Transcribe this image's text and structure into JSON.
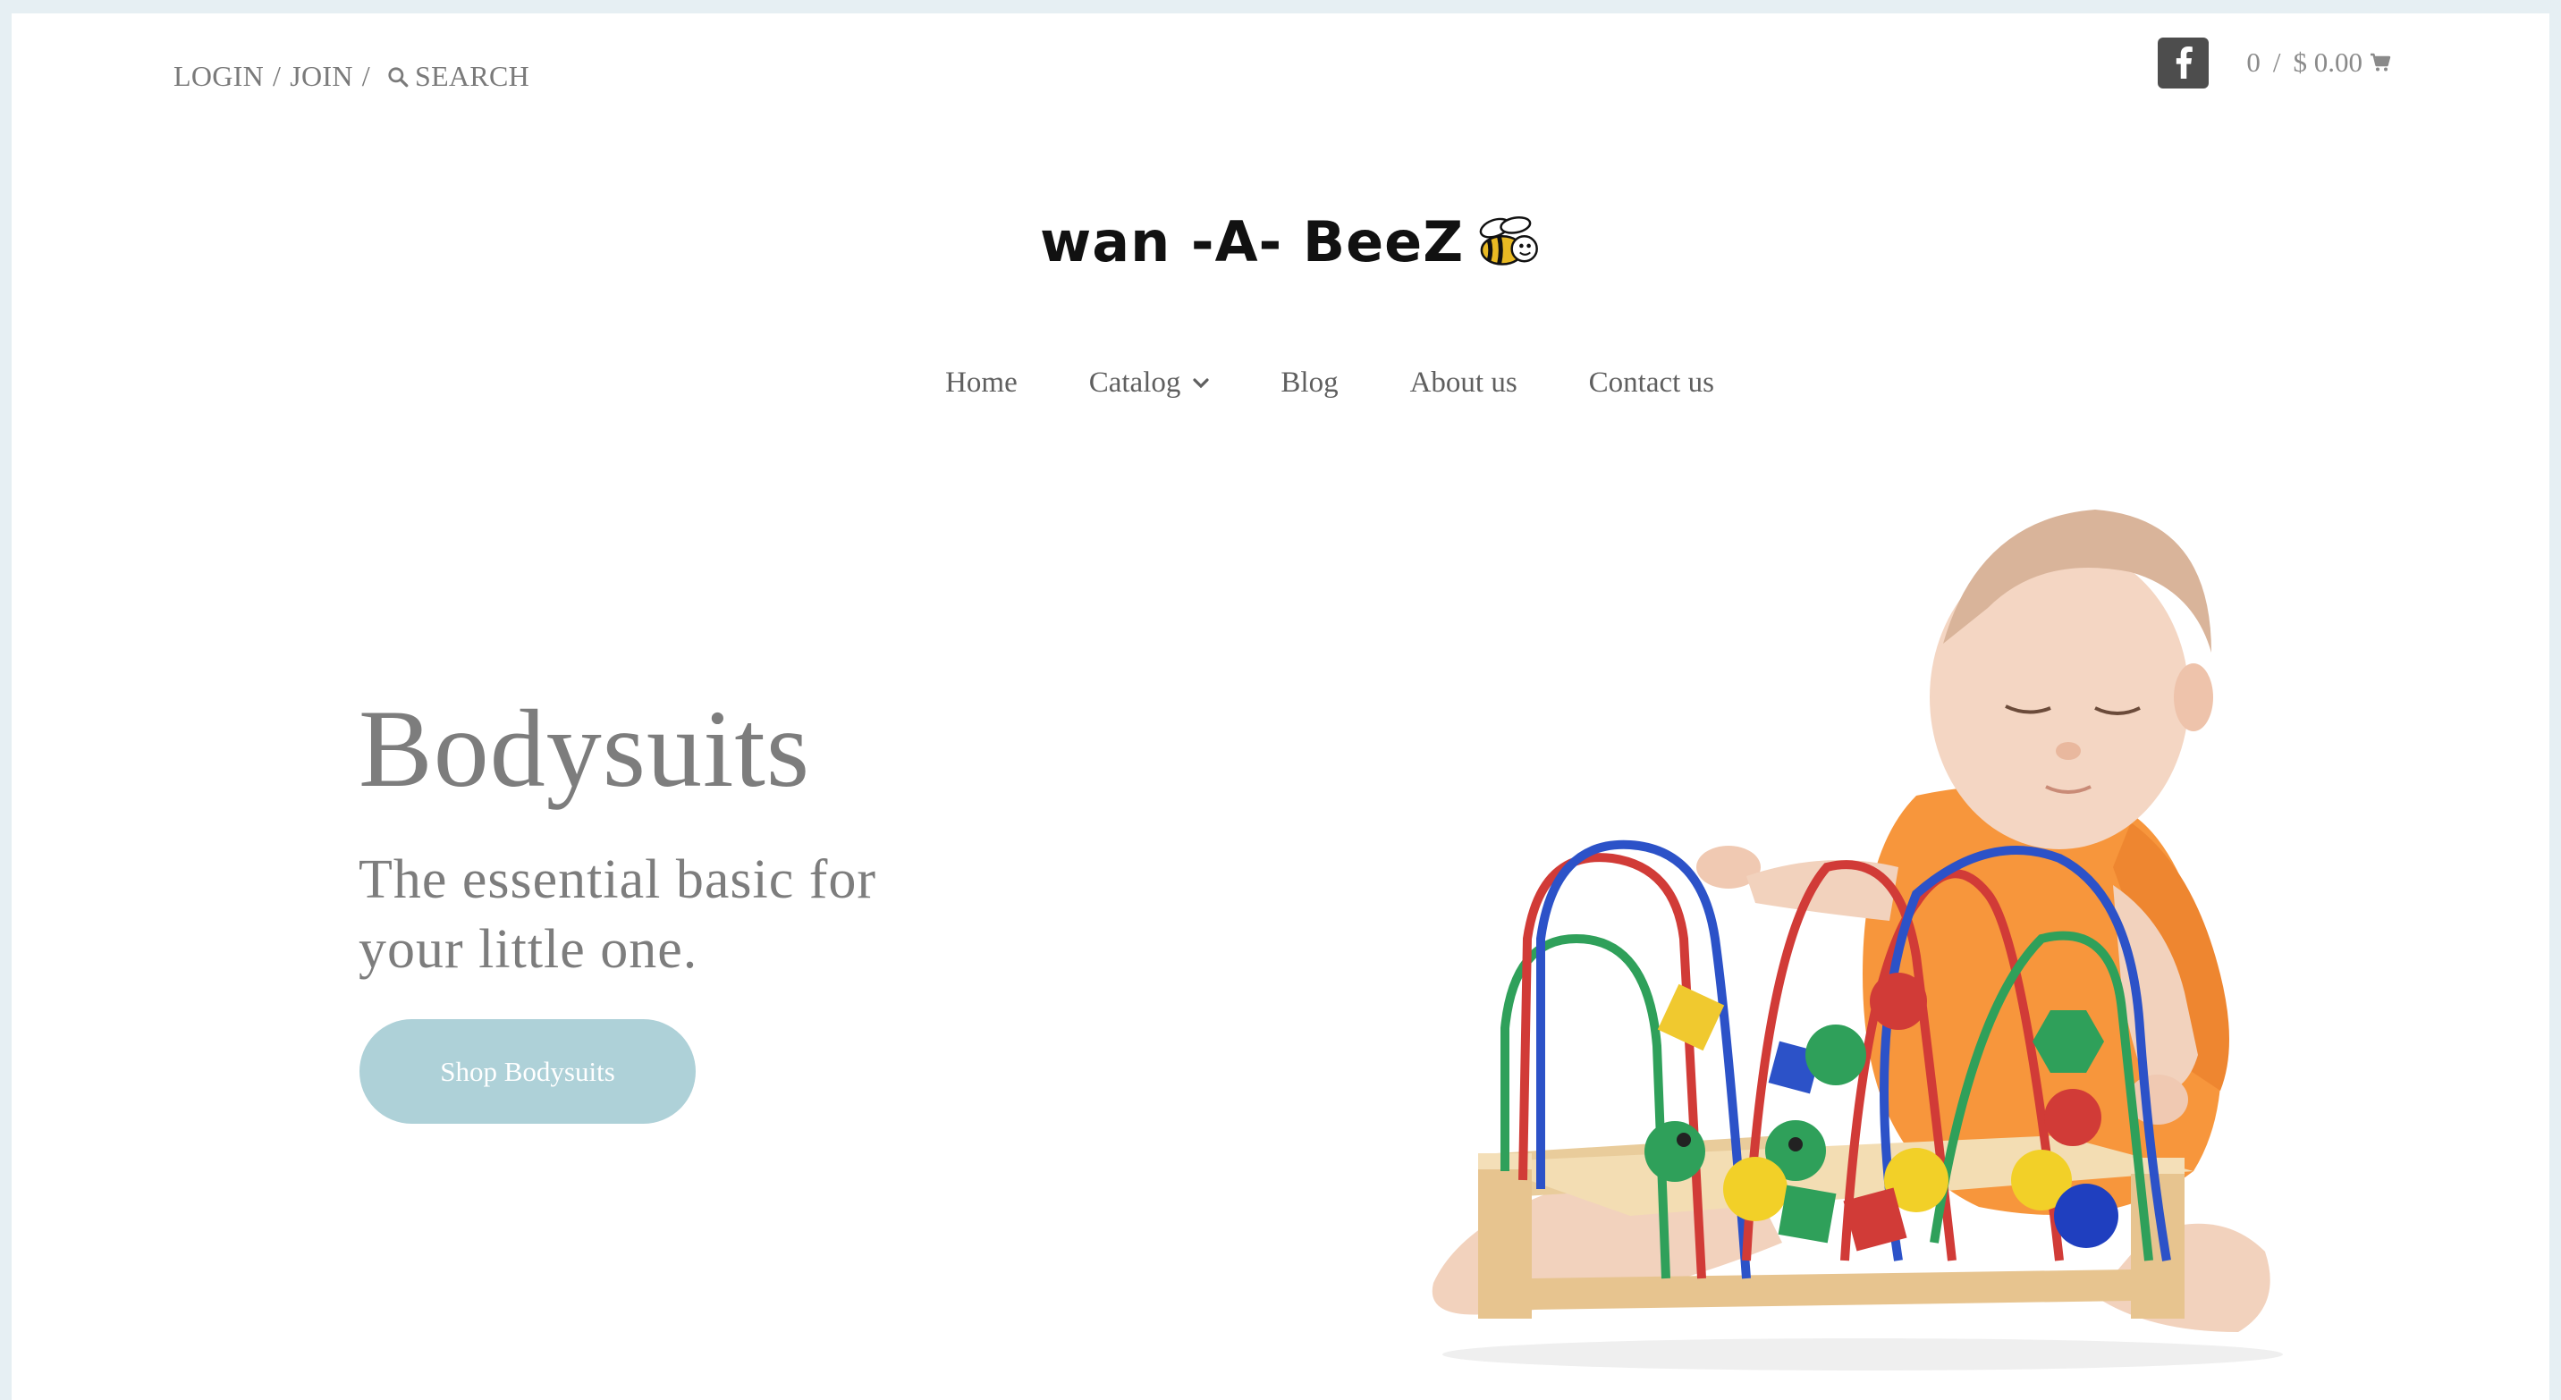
{
  "topbar": {
    "login_label": "LOGIN",
    "separator": "/",
    "join_label": "JOIN",
    "search_label": "SEARCH",
    "cart_count": "0",
    "cart_total": "$ 0.00"
  },
  "logo": {
    "text": "wan -A- BeeZ"
  },
  "nav": {
    "items": [
      {
        "label": "Home"
      },
      {
        "label": "Catalog"
      },
      {
        "label": "Blog"
      },
      {
        "label": "About us"
      },
      {
        "label": "Contact us"
      }
    ]
  },
  "hero": {
    "title": "Bodysuits",
    "subtitle": "The essential basic for your little one.",
    "button_label": "Shop Bodysuits"
  },
  "colors": {
    "page_bg": "#e6eff3",
    "accent_button": "#aed1d8",
    "text_gray": "#7d7d7d",
    "facebook_btn": "#4d4d4d"
  },
  "icons": {
    "search": "search-icon",
    "facebook": "facebook-icon",
    "cart": "cart-icon",
    "catalog_dropdown": "chevron-down-icon",
    "logo_bee": "bee-icon"
  }
}
